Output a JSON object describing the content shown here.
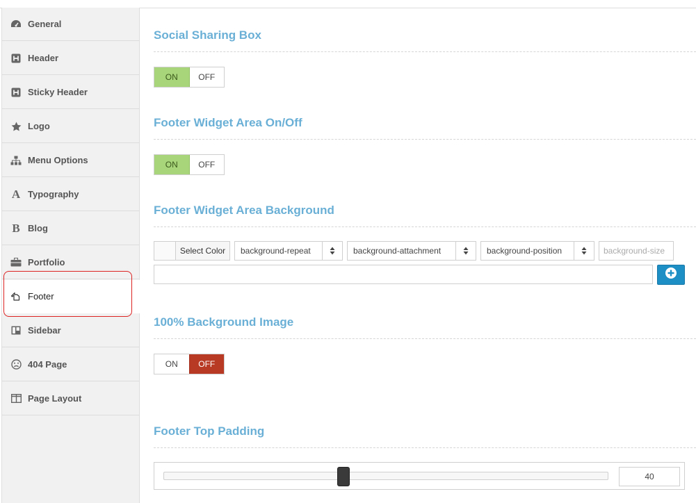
{
  "sidebar": {
    "items": [
      {
        "label": "General",
        "icon": "dashboard-icon"
      },
      {
        "label": "Header",
        "icon": "header-icon"
      },
      {
        "label": "Sticky Header",
        "icon": "header-icon"
      },
      {
        "label": "Logo",
        "icon": "star-icon"
      },
      {
        "label": "Menu Options",
        "icon": "sitemap-icon"
      },
      {
        "label": "Typography",
        "icon": "font-icon"
      },
      {
        "label": "Blog",
        "icon": "bold-icon"
      },
      {
        "label": "Portfolio",
        "icon": "briefcase-icon"
      },
      {
        "label": "Footer",
        "icon": "hand-pointer-icon",
        "active": true
      },
      {
        "label": "Sidebar",
        "icon": "columns-icon"
      },
      {
        "label": "404 Page",
        "icon": "frown-icon"
      },
      {
        "label": "Page Layout",
        "icon": "layout-icon"
      }
    ]
  },
  "sections": {
    "social_sharing": {
      "title": "Social Sharing Box",
      "on": "ON",
      "off": "OFF",
      "value": "on"
    },
    "footer_widget_onoff": {
      "title": "Footer Widget Area On/Off",
      "on": "ON",
      "off": "OFF",
      "value": "on"
    },
    "footer_widget_bg": {
      "title": "Footer Widget Area Background",
      "select_color": "Select Color",
      "repeat": "background-repeat",
      "attachment": "background-attachment",
      "position": "background-position",
      "size_placeholder": "background-size",
      "url_value": ""
    },
    "full_bg_image": {
      "title": "100% Background Image",
      "on": "ON",
      "off": "OFF",
      "value": "off"
    },
    "footer_top_padding": {
      "title": "Footer Top Padding",
      "value": "40",
      "fraction": 0.405
    }
  },
  "colors": {
    "accent_title": "#6ab0d6",
    "on_green": "#a8d47a",
    "off_red": "#b83a25",
    "add_button": "#1e8fc4",
    "highlight_ring": "#d22222"
  }
}
